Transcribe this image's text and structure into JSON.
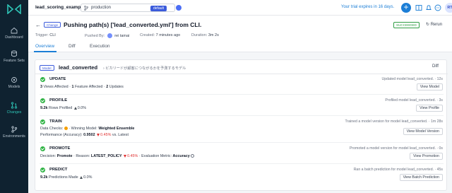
{
  "sidebar": {
    "items": [
      {
        "label": "Dashboard"
      },
      {
        "label": "Feature Sets"
      },
      {
        "label": "Models"
      },
      {
        "label": "Changes",
        "active": true
      },
      {
        "label": "Environments"
      }
    ]
  },
  "topbar": {
    "project": "lead_scoring_example",
    "branch": "production",
    "branch_badge": "default",
    "trial": "Your trial expires in 16 days.",
    "avatar": "RT"
  },
  "header": {
    "back": "←",
    "badge": "Change",
    "title": "Pushing path(s) ['lead_converted.yml'] from CLI.",
    "status": "SUCCEEDED",
    "rerun": "Rerun",
    "trigger_label": "Trigger:",
    "trigger_value": "CLI",
    "pushed_by_label": "Pushed By:",
    "pushed_by_value": "rei tamai",
    "created_label": "Created:",
    "created_value": "7 minutes ago",
    "duration_label": "Duration:",
    "duration_value": "3m 2s",
    "tabs": [
      "Overview",
      "Diff",
      "Execution"
    ]
  },
  "card": {
    "badge": "Model",
    "model_name": "lead_converted",
    "model_desc": "ビカリードが顧客につながるかを予測するモデル",
    "diff": "Diff",
    "steps": [
      {
        "name": "UPDATE",
        "line_parts": [
          "3",
          " Views Affected  ·  ",
          "1",
          " Feature Affected  ·  ",
          "2",
          " Updates"
        ],
        "right": "Updated model lead_converted.  ·  12s",
        "button": "View Model"
      },
      {
        "name": "PROFILE",
        "line_parts": [
          "9.2k",
          " Rows Profiled  ",
          "0.0%"
        ],
        "right": "Profiled model lead_converted.  ·  3s",
        "button": "View Profile"
      },
      {
        "name": "TRAIN",
        "line1_parts": [
          "Data Checks: ",
          " · Winning Model: ",
          "Weighted Ensemble"
        ],
        "line2_parts": [
          "Performance (Accuracy): ",
          "0.9502",
          "0.45%",
          " vs. Latest"
        ],
        "right": "Trained a model version for model lead_converted.  ·  1m 28s",
        "button": "View Model Version"
      },
      {
        "name": "PROMOTE",
        "line_parts": [
          "Decision: ",
          "Promote",
          " · Reason: ",
          "LATEST_POLICY",
          "0.45%",
          " · Evaluation Metric: ",
          "Accuracy"
        ],
        "right": "Promoted a model version for model lead_converted.  ·  0s",
        "button": "View Promotion"
      },
      {
        "name": "PREDICT",
        "line_parts": [
          "9.2k",
          " Predictions Made  ",
          "0.0%"
        ],
        "right": "Ran a batch prediction for model lead_converted.  ·  45s",
        "button": "View Batch Prediction"
      }
    ]
  }
}
